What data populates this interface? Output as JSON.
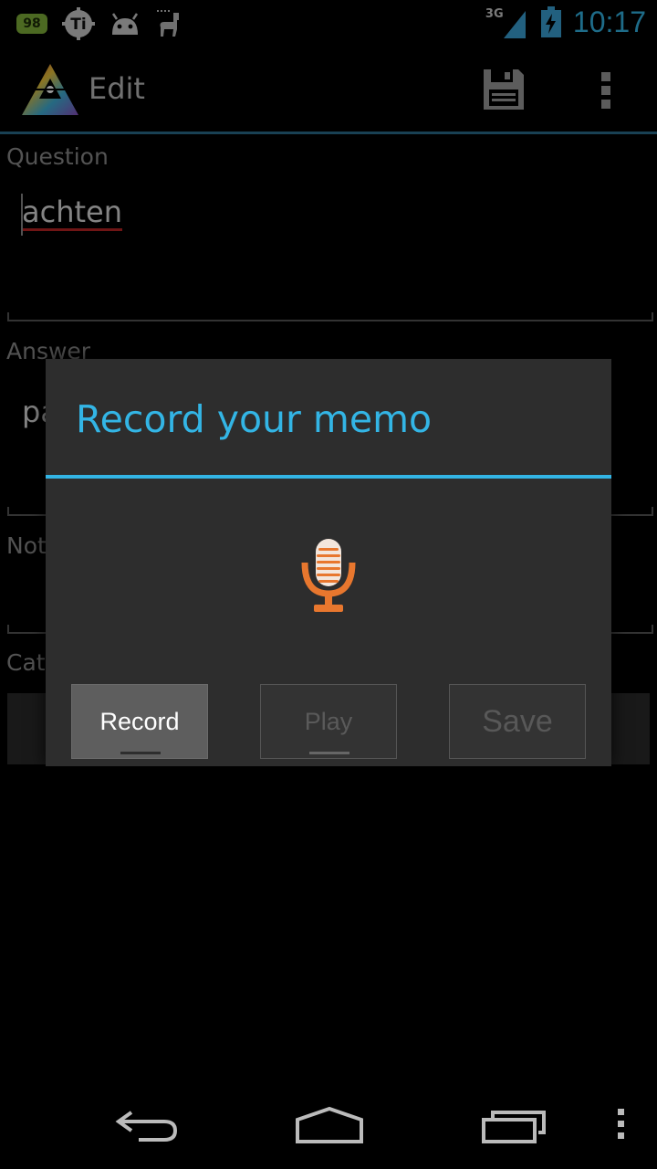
{
  "status_bar": {
    "battery_badge": "98",
    "network": "3G",
    "time": "10:17",
    "left_icons": [
      "battery-badge-icon",
      "titanium-app-icon",
      "android-icon",
      "llama-icon"
    ],
    "right_icons": [
      "signal-icon",
      "battery-charging-icon"
    ]
  },
  "action_bar": {
    "title": "Edit",
    "icons": [
      "app-logo-icon",
      "save-icon",
      "overflow-menu-icon"
    ]
  },
  "form": {
    "question_label": "Question",
    "question_value": "achten",
    "answer_label": "Answer",
    "answer_value_visible": "pa",
    "notes_label_visible": "Not",
    "category_label_visible": "Cat"
  },
  "dialog": {
    "title": "Record your memo",
    "icon": "microphone-icon",
    "buttons": {
      "record": "Record",
      "play": "Play",
      "save": "Save"
    }
  },
  "nav_bar": {
    "icons": [
      "back-icon",
      "home-icon",
      "recent-apps-icon",
      "menu-icon"
    ]
  },
  "colors": {
    "accent": "#33b5e5",
    "mic": "#e8772e",
    "spellcheck_underline": "#b92424"
  }
}
